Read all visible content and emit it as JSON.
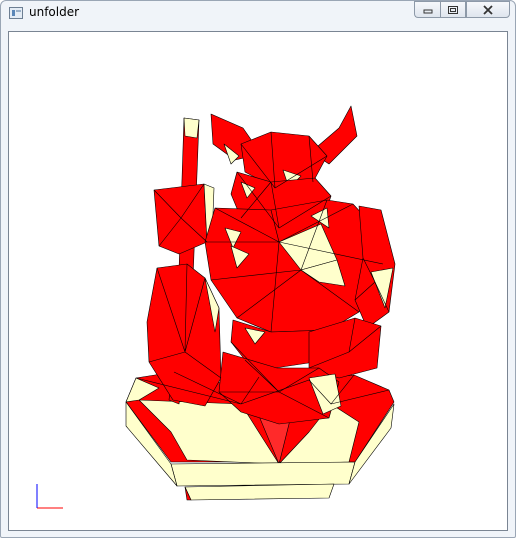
{
  "window": {
    "title": "unfolder",
    "app_icon": "app-window-icon",
    "controls": {
      "minimize": "minimize-icon",
      "maximize": "maximize-icon",
      "close": "close-icon"
    }
  },
  "viewport": {
    "model": "red-polygon-warrior-figure",
    "colors": {
      "face_front": "#ff0000",
      "face_back": "#ffffcc",
      "edge": "#000000",
      "axis_x": "#ff0000",
      "axis_y": "#0000ff"
    },
    "axes_gizmo": "axes-gizmo-icon"
  }
}
